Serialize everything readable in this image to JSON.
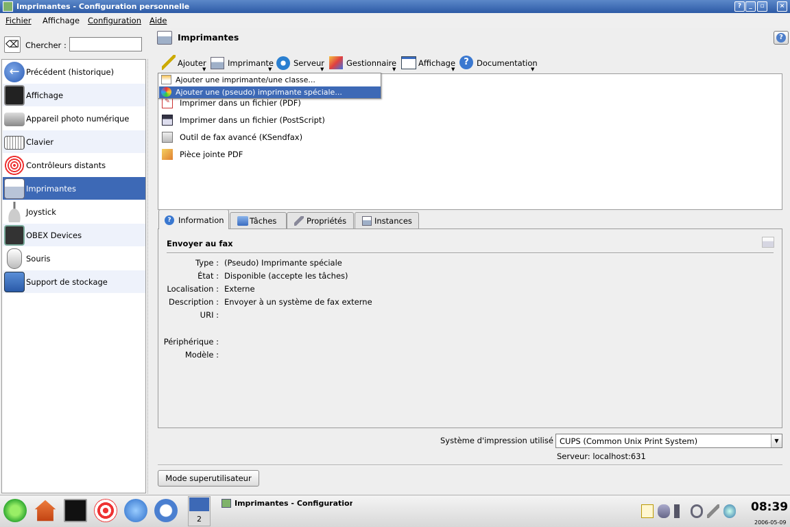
{
  "window": {
    "title": "Imprimantes - Configuration personnelle"
  },
  "menubar": {
    "items": [
      "Fichier",
      "Affichage",
      "Configuration",
      "Aide"
    ]
  },
  "search": {
    "label": "Chercher :",
    "value": ""
  },
  "sidebar": {
    "items": [
      {
        "label": "Précédent (historique)",
        "icon": "back-arrow-icon"
      },
      {
        "label": "Affichage",
        "icon": "display-icon"
      },
      {
        "label": "Appareil photo numérique",
        "icon": "camera-icon"
      },
      {
        "label": "Clavier",
        "icon": "keyboard-icon"
      },
      {
        "label": "Contrôleurs distants",
        "icon": "remote-control-icon"
      },
      {
        "label": "Imprimantes",
        "icon": "printer-icon"
      },
      {
        "label": "Joystick",
        "icon": "joystick-icon"
      },
      {
        "label": "OBEX Devices",
        "icon": "obex-icon"
      },
      {
        "label": "Souris",
        "icon": "mouse-icon"
      },
      {
        "label": "Support de stockage",
        "icon": "storage-icon"
      }
    ]
  },
  "header": {
    "title": "Imprimantes"
  },
  "toolbar": {
    "items": [
      "Ajouter",
      "Imprimante",
      "Serveur",
      "Gestionnaire",
      "Affichage",
      "Documentation"
    ]
  },
  "dropdown": {
    "items": [
      "Ajouter une imprimante/une classe...",
      "Ajouter une (pseudo) imprimante spéciale..."
    ]
  },
  "printers": [
    "Imprimer dans un fichier (PDF)",
    "Imprimer dans un fichier (PostScript)",
    "Outil de fax avancé (KSendfax)",
    "Pièce jointe PDF"
  ],
  "tabs": [
    "Information",
    "Tâches",
    "Propriétés",
    "Instances"
  ],
  "info": {
    "title": "Envoyer au fax",
    "rows": [
      {
        "key": "Type :",
        "value": "(Pseudo) Imprimante spéciale"
      },
      {
        "key": "État :",
        "value": "Disponible (accepte les tâches)"
      },
      {
        "key": "Localisation :",
        "value": "Externe"
      },
      {
        "key": "Description :",
        "value": "Envoyer à un système de fax externe"
      },
      {
        "key": "URI :",
        "value": ""
      },
      {
        "key": "Périphérique :",
        "value": ""
      },
      {
        "key": "Modèle :",
        "value": ""
      }
    ]
  },
  "bottom": {
    "system_label": "Système d'impression utilisé :",
    "system_value": "CUPS (Common Unix Print System)",
    "server": "Serveur: localhost:631",
    "superuser_button": "Mode superutilisateur"
  },
  "taskbar": {
    "pager": "2",
    "task_label": "Imprimantes - Configuration per",
    "clock": "08:39",
    "date": "2006-05-09"
  },
  "colors": {
    "selection": "#3d69b6",
    "titlebar": "#2d5aa6"
  }
}
